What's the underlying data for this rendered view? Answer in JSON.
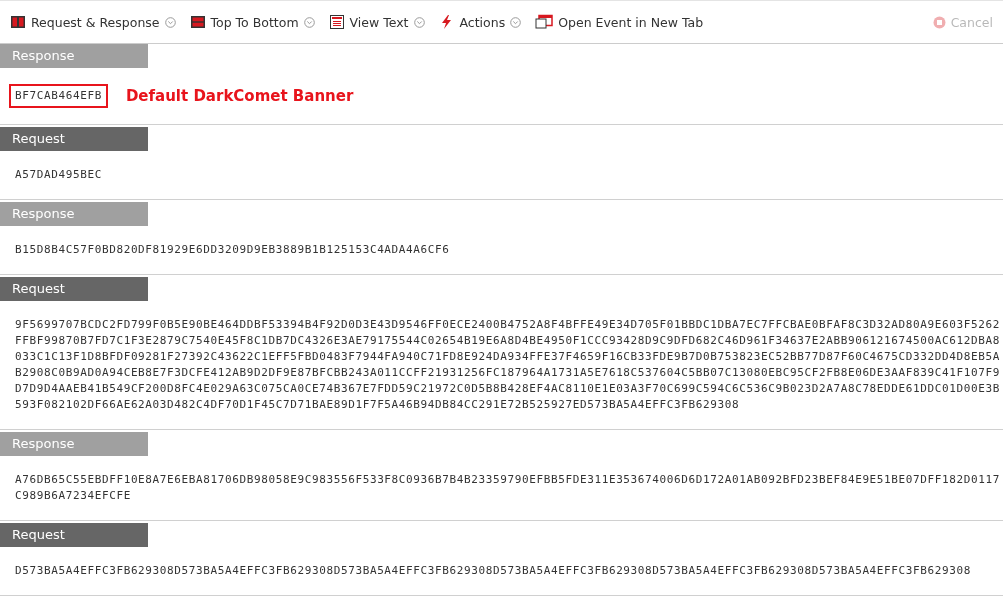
{
  "toolbar": {
    "items": [
      {
        "label": "Request & Response",
        "dropdown": true
      },
      {
        "label": "Top To Bottom",
        "dropdown": true
      },
      {
        "label": "View Text",
        "dropdown": true
      },
      {
        "label": "Actions",
        "dropdown": true
      },
      {
        "label": "Open Event in New Tab",
        "dropdown": false
      }
    ],
    "cancel": {
      "label": "Cancel",
      "disabled": true
    }
  },
  "sections": [
    {
      "kind": "response",
      "title": "Response",
      "content": "BF7CAB464EFB",
      "highlighted": true,
      "annotation": "Default DarkComet Banner"
    },
    {
      "kind": "request",
      "title": "Request",
      "content": "A57DAD495BEC",
      "highlighted": false
    },
    {
      "kind": "response",
      "title": "Response",
      "content": "B15D8B4C57F0BD820DF81929E6DD3209D9EB3889B1B125153C4ADA4A6CF6",
      "highlighted": false
    },
    {
      "kind": "request",
      "title": "Request",
      "content": "9F5699707BCDC2FD799F0B5E90BE464DDBF53394B4F92D0D3E43D9546FF0ECE2400B4752A8F4BFFE49E34D705F01BBDC1DBA7EC7FFCBAE0BFAF8C3D32AD80A9E603F5262FFBF99870B7FD7C1F3E2879C7540E45F8C1DB7DC4326E3AE79175544C02654B19E6A8D4BE4950F1CCC93428D9C9DFD682C46D961F34637E2ABB906121674500AC612DBA8033C1C13F1D8BFDF09281F27392C43622C1EFF5FBD0483F7944FA940C71FD8E924DA934FFE37F4659F16CB33FDE9B7D0B753823EC52BB77D87F60C4675CD332DD4D8EB5AB2908C0B9AD0A94CEB8E7F3DCFE412AB9D2DF9E87BFCBB243A011CCFF21931256FC187964A1731A5E7618C537604C5BB07C13080EBC95CF2FB8E06DE3AAF839C41F107F9D7D9D4AAEB41B549CF200D8FC4E029A63C075CA0CE74B367E7FDD59C21972C0D5B8B428EF4AC8110E1E03A3F70C699C594C6C536C9B023D2A7A8C78EDDE61DDC01D00E3B593F082102DF66AE62A03D482C4DF70D1F45C7D71BAE89D1F7F5A46B94DB84CC291E72B525927ED573BA5A4EFFC3FB629308",
      "highlighted": false
    },
    {
      "kind": "response",
      "title": "Response",
      "content": "A76DB65C55EBDFF10E8A7E6EBA81706DB98058E9C983556F533F8C0936B7B4B23359790EFBB5FDE311E353674006D6D172A01AB092BFD23BEF84E9E51BE07DFF182D0117C989B6A7234EFCFE",
      "highlighted": false
    },
    {
      "kind": "request",
      "title": "Request",
      "content": "D573BA5A4EFFC3FB629308D573BA5A4EFFC3FB629308D573BA5A4EFFC3FB629308D573BA5A4EFFC3FB629308D573BA5A4EFFC3FB629308D573BA5A4EFFC3FB629308",
      "highlighted": false
    }
  ]
}
